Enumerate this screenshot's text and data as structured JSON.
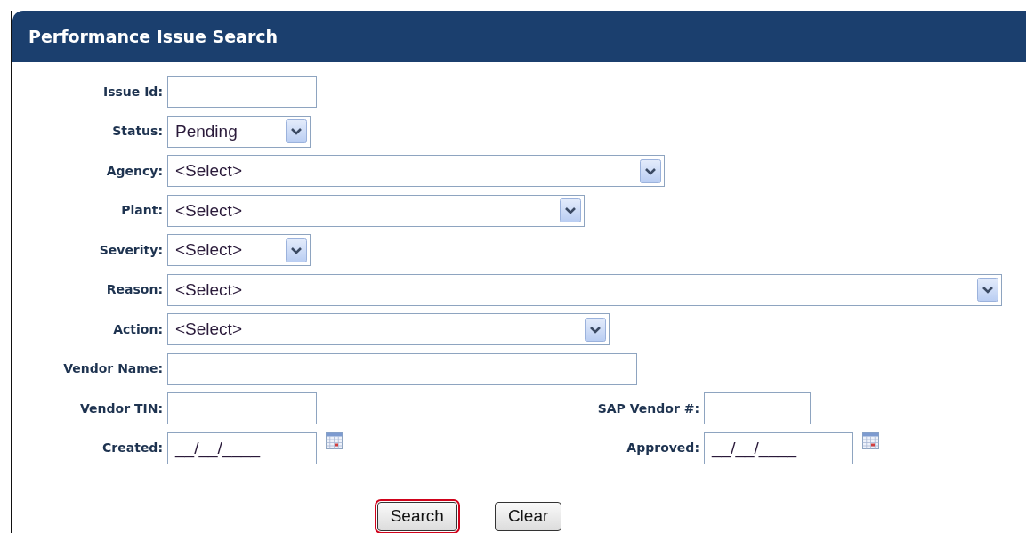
{
  "panel": {
    "title": "Performance Issue Search"
  },
  "rows": [
    {
      "fields": [
        {
          "label": "Issue Id:",
          "kind": "text"
        }
      ]
    },
    {
      "fields": [
        {
          "label": "Status:",
          "kind": "select",
          "value": "Pending"
        }
      ]
    },
    {
      "fields": [
        {
          "label": "Agency:",
          "kind": "select",
          "value": "<Select>"
        }
      ]
    },
    {
      "fields": [
        {
          "label": "Plant:",
          "kind": "select",
          "value": "<Select>"
        }
      ]
    },
    {
      "fields": [
        {
          "label": "Severity:",
          "kind": "select",
          "value": "<Select>"
        }
      ]
    },
    {
      "fields": [
        {
          "label": "Reason:",
          "kind": "select",
          "value": "<Select>"
        }
      ]
    },
    {
      "fields": [
        {
          "label": "Action:",
          "kind": "select",
          "value": "<Select>"
        }
      ]
    },
    {
      "fields": [
        {
          "label": "Vendor Name:",
          "kind": "text"
        }
      ]
    },
    {
      "fields": [
        {
          "label": "Vendor TIN:",
          "kind": "text"
        },
        {
          "label": "SAP Vendor #:",
          "kind": "text"
        }
      ]
    },
    {
      "fields": [
        {
          "label": "Created:",
          "kind": "date",
          "value": "__/__/____"
        },
        {
          "label": "Approved:",
          "kind": "date",
          "value": "__/__/____"
        }
      ]
    }
  ],
  "buttons": [
    {
      "label": "Search",
      "focused": true
    },
    {
      "label": "Clear",
      "focused": false
    }
  ]
}
